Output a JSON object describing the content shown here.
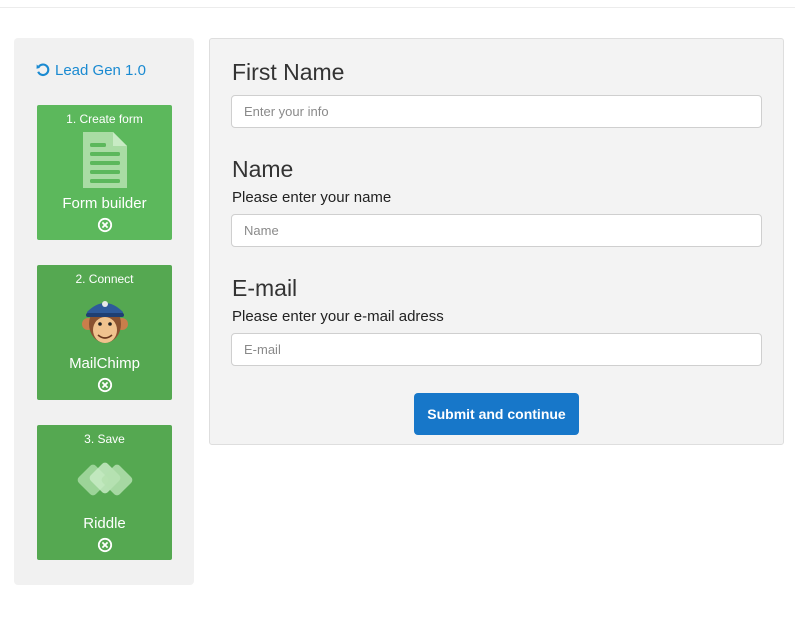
{
  "brand": {
    "label": "Lead Gen 1.0",
    "color": "#1a8ad1"
  },
  "steps": [
    {
      "title": "1. Create form",
      "name": "Form builder",
      "icon": "document-icon",
      "color": "#5cb85c"
    },
    {
      "title": "2. Connect",
      "name": "MailChimp",
      "icon": "mailchimp-logo-icon",
      "color": "#55a851"
    },
    {
      "title": "3. Save",
      "name": "Riddle",
      "icon": "riddle-logo-icon",
      "color": "#55a851"
    }
  ],
  "form": {
    "first_name": {
      "label": "First Name",
      "placeholder": "Enter your info"
    },
    "name": {
      "label": "Name",
      "sublabel": "Please enter your name",
      "placeholder": "Name"
    },
    "email": {
      "label": "E-mail",
      "sublabel": "Please enter your e-mail adress",
      "placeholder": "E-mail"
    },
    "submit_label": "Submit and continue",
    "submit_color": "#1777c9"
  }
}
